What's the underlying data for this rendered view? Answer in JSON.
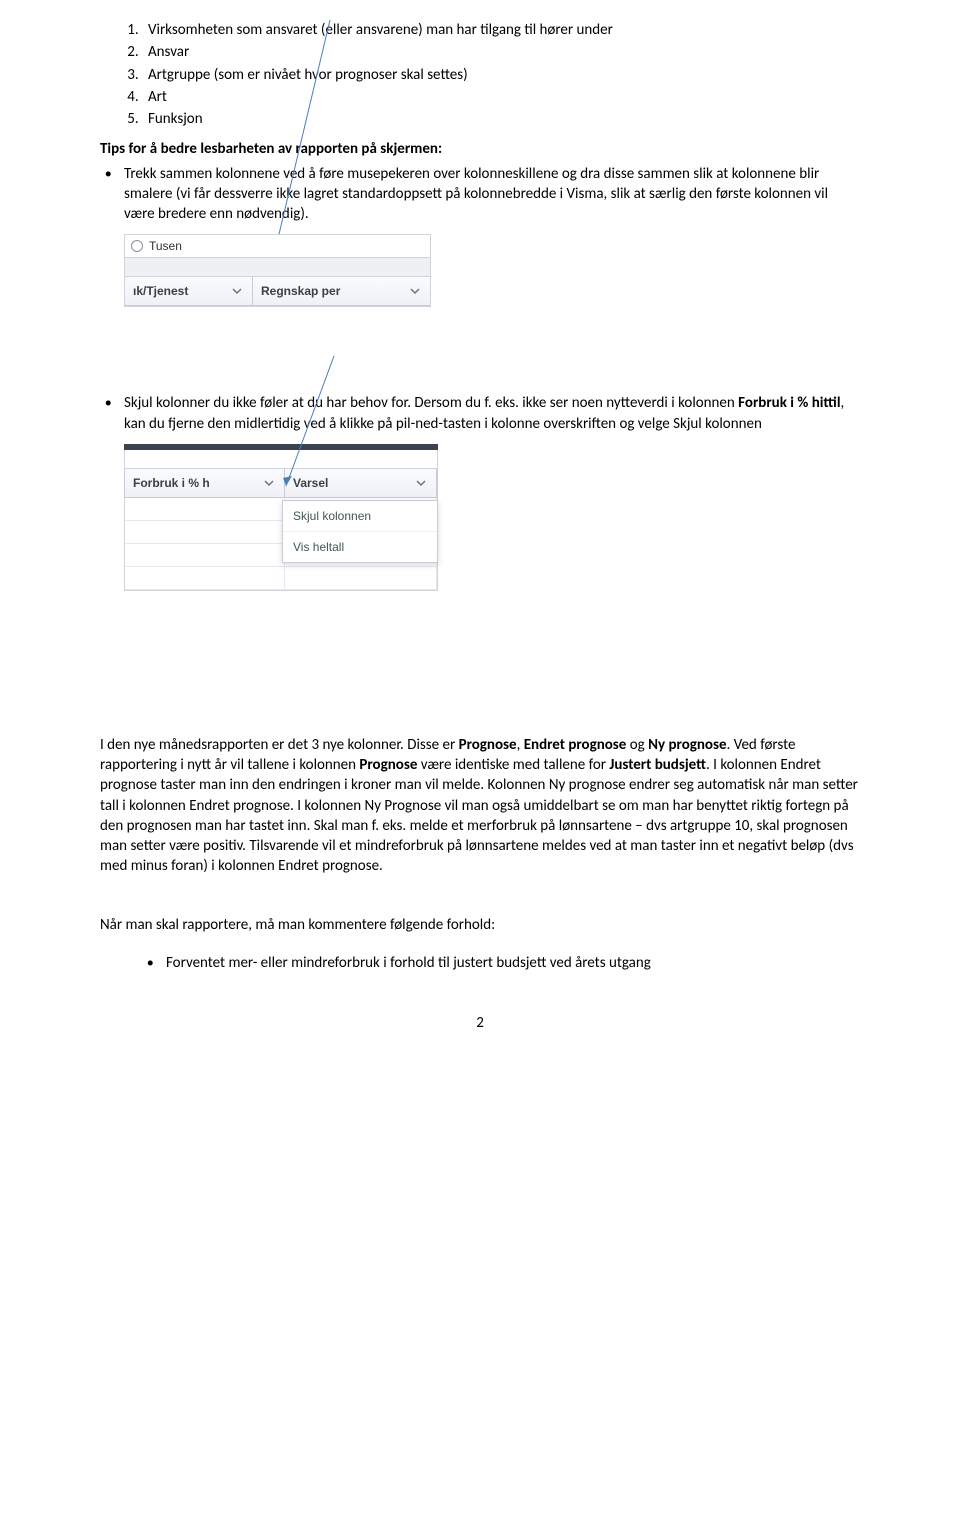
{
  "numbered_list": [
    "Virksomheten som ansvaret (eller ansvarene) man har tilgang til hører under",
    "Ansvar",
    "Artgruppe (som er nivået hvor prognoser skal settes)",
    "Art",
    "Funksjon"
  ],
  "tips_heading": "Tips for å bedre lesbarheten av rapporten på skjermen:",
  "bullet1": "Trekk sammen kolonnene ved å føre musepekeren over kolonneskillene og dra disse sammen slik at kolonnene blir smalere (vi får dessverre ikke lagret standardoppsett på kolonnebredde i Visma, slik at særlig den første kolonnen vil være bredere enn nødvendig).",
  "shot1": {
    "radio_label": "Tusen",
    "col1": "ık/Tjenest",
    "col2": "Regnskap per"
  },
  "bullet2": {
    "part1": "Skjul kolonner du ikke føler at du har behov for. Dersom du f. eks. ikke ser noen nytteverdi i kolonnen ",
    "bold1": "Forbruk i % hittil",
    "part2": ", kan du fjerne den midlertidig ved å klikke på pil-ned-tasten i kolonne overskriften og velge Skjul kolonnen"
  },
  "shot2": {
    "colA": "Forbruk i % h",
    "colB": "Varsel",
    "menu1": "Skjul kolonnen",
    "menu2": "Vis heltall"
  },
  "para1": {
    "t1": "I den nye månedsrapporten er det 3 nye kolonner. Disse er ",
    "b1": "Prognose",
    "t2": ", ",
    "b2": "Endret prognose",
    "t3": " og ",
    "b3": "Ny prognose",
    "t4": ". Ved første rapportering i nytt år vil tallene i kolonnen ",
    "b4": "Prognose",
    "t5": " være identiske med tallene for ",
    "b5": "Justert budsjett",
    "t6": ". I kolonnen Endret prognose taster man inn den endringen i kroner man vil melde. Kolonnen Ny prognose endrer seg automatisk når man setter tall i kolonnen Endret prognose. I kolonnen Ny Prognose vil man også umiddelbart se om man har benyttet riktig fortegn på den prognosen man har tastet inn. Skal man f. eks. melde et merforbruk på lønnsartene – dvs artgruppe 10, skal prognosen man setter være positiv. Tilsvarende vil et mindreforbruk på lønnsartene meldes ved at man taster inn et negativt beløp (dvs med minus foran) i kolonnen Endret prognose."
  },
  "para2": "Når man skal rapportere, må man kommentere følgende forhold:",
  "bullet3": "Forventet mer- eller mindreforbruk i forhold til justert budsjett ved årets utgang",
  "page_number": "2"
}
